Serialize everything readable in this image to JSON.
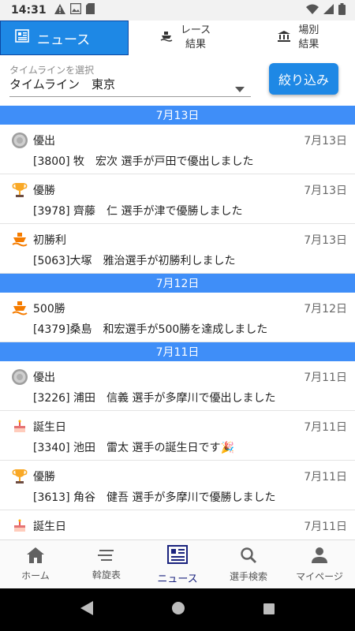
{
  "status": {
    "time": "14:31"
  },
  "tabs": [
    {
      "label": "ニュース"
    },
    {
      "line1": "レース",
      "line2": "結果"
    },
    {
      "line1": "場別",
      "line2": "結果"
    }
  ],
  "filter": {
    "label": "タイムラインを選択",
    "value": "タイムライン　東京",
    "button": "絞り込み"
  },
  "groups": [
    {
      "date": "7月13日",
      "items": [
        {
          "icon": "medal-icon",
          "title": "優出",
          "date": "7月13日",
          "body": "[3800] 牧　宏次 選手が戸田で優出しました"
        },
        {
          "icon": "trophy-icon",
          "title": "優勝",
          "date": "7月13日",
          "body": "[3978] 齊藤　仁 選手が津で優勝しました"
        },
        {
          "icon": "boat-icon",
          "title": "初勝利",
          "date": "7月13日",
          "body": "[5063]大塚　雅治選手が初勝利しました"
        }
      ]
    },
    {
      "date": "7月12日",
      "items": [
        {
          "icon": "boat-icon",
          "title": "500勝",
          "date": "7月12日",
          "body": "[4379]桑島　和宏選手が500勝を達成しました"
        }
      ]
    },
    {
      "date": "7月11日",
      "items": [
        {
          "icon": "medal-icon",
          "title": "優出",
          "date": "7月11日",
          "body": "[3226] 浦田　信義 選手が多摩川で優出しました"
        },
        {
          "icon": "cake-icon",
          "title": "誕生日",
          "date": "7月11日",
          "body": "[3340] 池田　雷太 選手の誕生日です🎉"
        },
        {
          "icon": "trophy-icon",
          "title": "優勝",
          "date": "7月11日",
          "body": "[3613] 角谷　健吾 選手が多摩川で優勝しました"
        },
        {
          "icon": "cake-icon",
          "title": "誕生日",
          "date": "7月11日",
          "body": ""
        }
      ]
    }
  ],
  "nav": [
    {
      "label": "ホーム",
      "icon": "home-icon"
    },
    {
      "label": "斡旋表",
      "icon": "list-icon"
    },
    {
      "label": "ニュース",
      "icon": "newspaper-icon",
      "active": true
    },
    {
      "label": "選手検索",
      "icon": "search-icon"
    },
    {
      "label": "マイページ",
      "icon": "person-icon"
    }
  ],
  "colors": {
    "accent": "#1e88e5",
    "date_header": "#3f8ef8",
    "nav_active": "#1a237e"
  }
}
